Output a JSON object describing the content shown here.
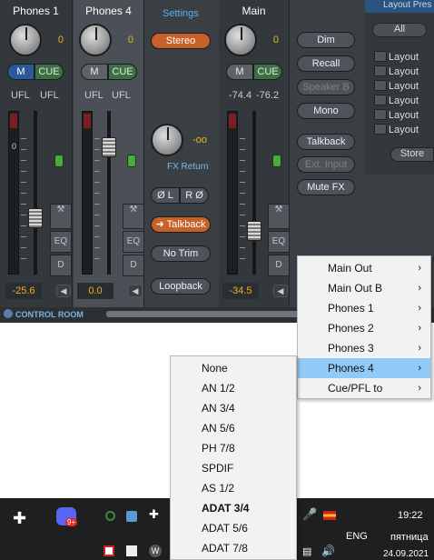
{
  "channels": [
    {
      "title": "Phones 1",
      "gain": "0",
      "mute": "M",
      "cue": "CUE",
      "level_l": "UFL",
      "level_r": "UFL",
      "volume": "-25.6",
      "selected": false
    },
    {
      "title": "Phones 4",
      "gain": "0",
      "mute": "M",
      "cue": "CUE",
      "level_l": "UFL",
      "level_r": "UFL",
      "volume": "0.0",
      "selected": true
    },
    {
      "title": "Main",
      "gain": "0",
      "mute": "M",
      "cue": "CUE",
      "level_l": "-74.4",
      "level_r": "-76.2",
      "volume": "-34.5",
      "selected": false
    }
  ],
  "meter_scale": "0",
  "side_tabs": {
    "eq": "EQ",
    "dyn": "D"
  },
  "settings": {
    "title": "Settings",
    "stereo": "Stereo",
    "fx_value": "-oo",
    "fx_return": "FX Return",
    "phase_l": "Ø L",
    "phase_r": "R Ø",
    "talkback": "Talkback",
    "no_trim": "No Trim",
    "loopback": "Loopback"
  },
  "main_buttons": [
    "Dim",
    "Recall",
    "Speaker B",
    "Mono",
    "Talkback",
    "Ext. Input",
    "Mute FX"
  ],
  "layout": {
    "header": "Layout Pres",
    "all": "All",
    "items": [
      "Layout",
      "Layout",
      "Layout",
      "Layout",
      "Layout",
      "Layout"
    ],
    "store": "Store"
  },
  "control_room": "CONTROL ROOM",
  "menu_outputs": [
    "Main Out",
    "Main Out B",
    "Phones 1",
    "Phones 2",
    "Phones 3",
    "Phones 4",
    "Cue/PFL to"
  ],
  "menu_outputs_highlight": "Phones 4",
  "menu_inputs": [
    "None",
    "AN 1/2",
    "AN 3/4",
    "AN 5/6",
    "PH 7/8",
    "SPDIF",
    "AS 1/2",
    "ADAT 3/4",
    "ADAT 5/6",
    "ADAT 7/8"
  ],
  "menu_inputs_bold": "ADAT 3/4",
  "taskbar": {
    "badge": "9+",
    "lang": "ENG",
    "time": "19:22",
    "day": "пятница",
    "date": "24.09.2021"
  },
  "colors": {
    "accent_orange": "#c8602a",
    "highlight": "#91c9f7",
    "value_yellow": "#f0b020",
    "cue_green": "#3f6e44",
    "mute_blue": "#2a5a9a"
  }
}
